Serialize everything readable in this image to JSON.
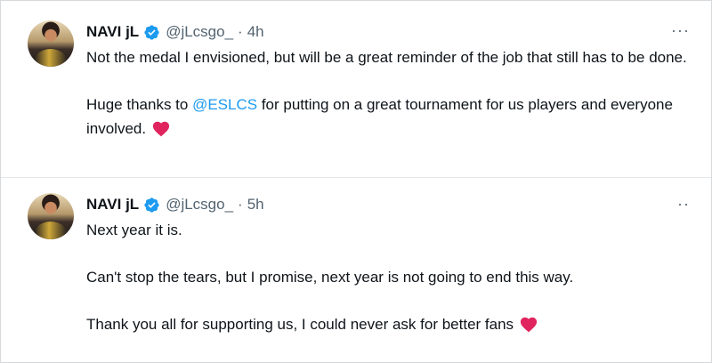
{
  "tweets": [
    {
      "name": "NAVI jL",
      "handle": "@jLcsgo_",
      "separator": "·",
      "time": "4h",
      "more": "···",
      "paragraphs": {
        "p1": "Not the medal I envisioned, but will be a great reminder of the job that still has to be done.",
        "p2_before": "Huge thanks to ",
        "p2_mention": "@ESLCS",
        "p2_after": " for putting on a great tournament for us players and everyone involved."
      }
    },
    {
      "name": "NAVI jL",
      "handle": "@jLcsgo_",
      "separator": "·",
      "time": "5h",
      "more": "··",
      "paragraphs": {
        "p1": "Next year it is.",
        "p2": "Can't stop the tears, but I promise, next year is not going to end this way.",
        "p3": "Thank you all for supporting us, I could never ask for better fans"
      }
    }
  ],
  "colors": {
    "accent": "#1d9bf0",
    "heart": "#e0245e",
    "secondary_text": "#536471"
  },
  "icons": {
    "verified": "verified-badge-icon",
    "heart": "red-heart-emoji-icon",
    "more": "more-options-icon"
  }
}
